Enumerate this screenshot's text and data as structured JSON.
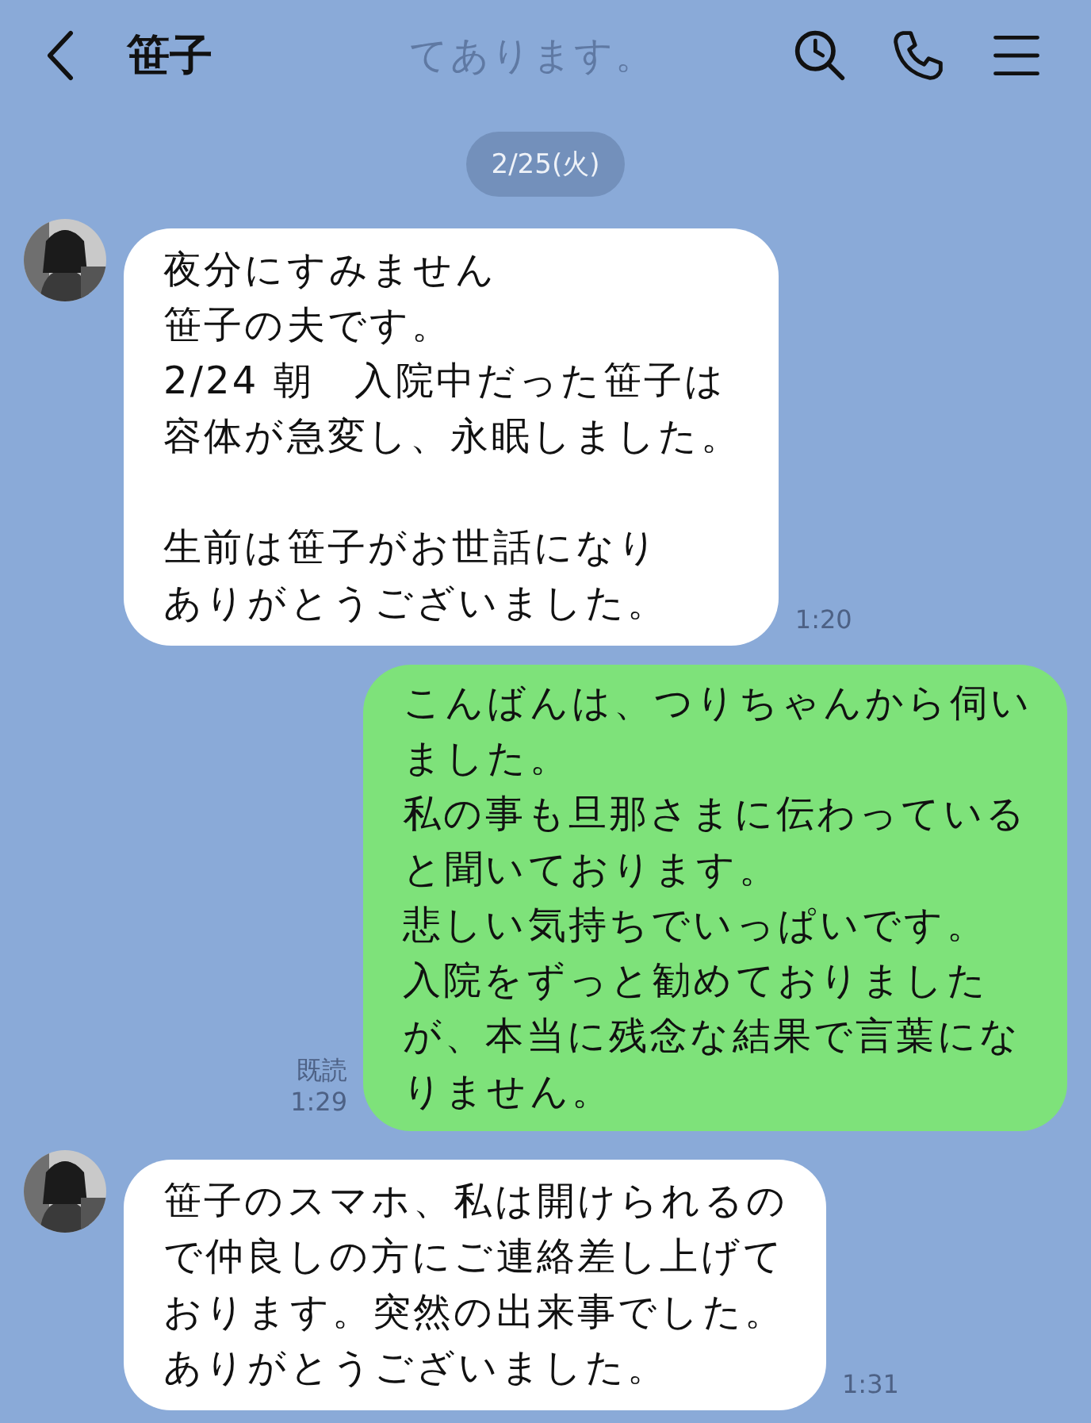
{
  "header": {
    "title": "笹子",
    "ghost_message": "てあります。"
  },
  "date_label": "2/25(火)",
  "messages": [
    {
      "kind": "received",
      "paragraphs": [
        [
          "夜分にすみません",
          "笹子の夫です。",
          "2/24 朝　入院中だった笹子は",
          "容体が急変し、永眠しました。"
        ],
        [
          "生前は笹子がお世話になり",
          "ありがとうございました。"
        ]
      ],
      "time": "1:20"
    },
    {
      "kind": "sent",
      "paragraphs": [
        [
          "こんばんは、つりちゃんから伺い",
          "ました。",
          "私の事も旦那さまに伝わっている",
          "と聞いております。",
          "悲しい気持ちでいっぱいです。",
          "入院をずっと勧めておりました",
          "が、本当に残念な結果で言葉にな",
          "りません。"
        ]
      ],
      "read": "既読",
      "time": "1:29"
    },
    {
      "kind": "received",
      "paragraphs": [
        [
          "笹子のスマホ、私は開けられるの",
          "で仲良しの方にご連絡差し上げて",
          "おります。突然の出来事でした。",
          "ありがとうございました。"
        ]
      ],
      "time": "1:31"
    }
  ]
}
